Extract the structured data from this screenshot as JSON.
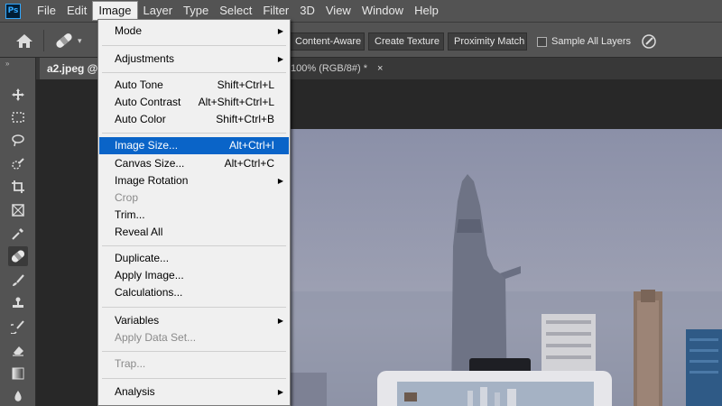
{
  "app": {
    "logo_text": "Ps"
  },
  "menubar": {
    "items": [
      "File",
      "Edit",
      "Image",
      "Layer",
      "Type",
      "Select",
      "Filter",
      "3D",
      "View",
      "Window",
      "Help"
    ],
    "active": "Image"
  },
  "optionsbar": {
    "content_aware": "Content-Aware",
    "create_texture": "Create Texture",
    "proximity_match": "Proximity Match",
    "sample_all_layers": "Sample All Layers",
    "sample_all_checked": false
  },
  "document_tab": {
    "name": "a2.jpeg @",
    "info": "100% (RGB/8#) *",
    "close": "×"
  },
  "image_menu": {
    "items": [
      {
        "label": "Mode",
        "shortcut": "",
        "submenu": true,
        "enabled": true
      },
      {
        "label": "Adjustments",
        "shortcut": "",
        "submenu": true,
        "enabled": true
      },
      {
        "label": "Auto Tone",
        "shortcut": "Shift+Ctrl+L",
        "submenu": false,
        "enabled": true
      },
      {
        "label": "Auto Contrast",
        "shortcut": "Alt+Shift+Ctrl+L",
        "submenu": false,
        "enabled": true
      },
      {
        "label": "Auto Color",
        "shortcut": "Shift+Ctrl+B",
        "submenu": false,
        "enabled": true
      },
      {
        "label": "Image Size...",
        "shortcut": "Alt+Ctrl+I",
        "submenu": false,
        "enabled": true,
        "highlighted": true
      },
      {
        "label": "Canvas Size...",
        "shortcut": "Alt+Ctrl+C",
        "submenu": false,
        "enabled": true
      },
      {
        "label": "Image Rotation",
        "shortcut": "",
        "submenu": true,
        "enabled": true
      },
      {
        "label": "Crop",
        "shortcut": "",
        "submenu": false,
        "enabled": false
      },
      {
        "label": "Trim...",
        "shortcut": "",
        "submenu": false,
        "enabled": true
      },
      {
        "label": "Reveal All",
        "shortcut": "",
        "submenu": false,
        "enabled": true
      },
      {
        "label": "Duplicate...",
        "shortcut": "",
        "submenu": false,
        "enabled": true
      },
      {
        "label": "Apply Image...",
        "shortcut": "",
        "submenu": false,
        "enabled": true
      },
      {
        "label": "Calculations...",
        "shortcut": "",
        "submenu": false,
        "enabled": true
      },
      {
        "label": "Variables",
        "shortcut": "",
        "submenu": true,
        "enabled": true
      },
      {
        "label": "Apply Data Set...",
        "shortcut": "",
        "submenu": false,
        "enabled": false
      },
      {
        "label": "Trap...",
        "shortcut": "",
        "submenu": false,
        "enabled": false
      },
      {
        "label": "Analysis",
        "shortcut": "",
        "submenu": true,
        "enabled": true
      }
    ]
  },
  "toolbar": {
    "tools": [
      "move-tool",
      "marquee-tool",
      "lasso-tool",
      "quick-selection-tool",
      "crop-tool",
      "frame-tool",
      "eyedropper-tool",
      "healing-brush-tool",
      "brush-tool",
      "clone-stamp-tool",
      "history-brush-tool",
      "eraser-tool",
      "gradient-tool",
      "blur-tool"
    ],
    "selected": "healing-brush-tool"
  },
  "colors": {
    "menu_highlight": "#0a64c8",
    "panel_gray": "#535353",
    "menu_bg": "#f0f0f0"
  }
}
